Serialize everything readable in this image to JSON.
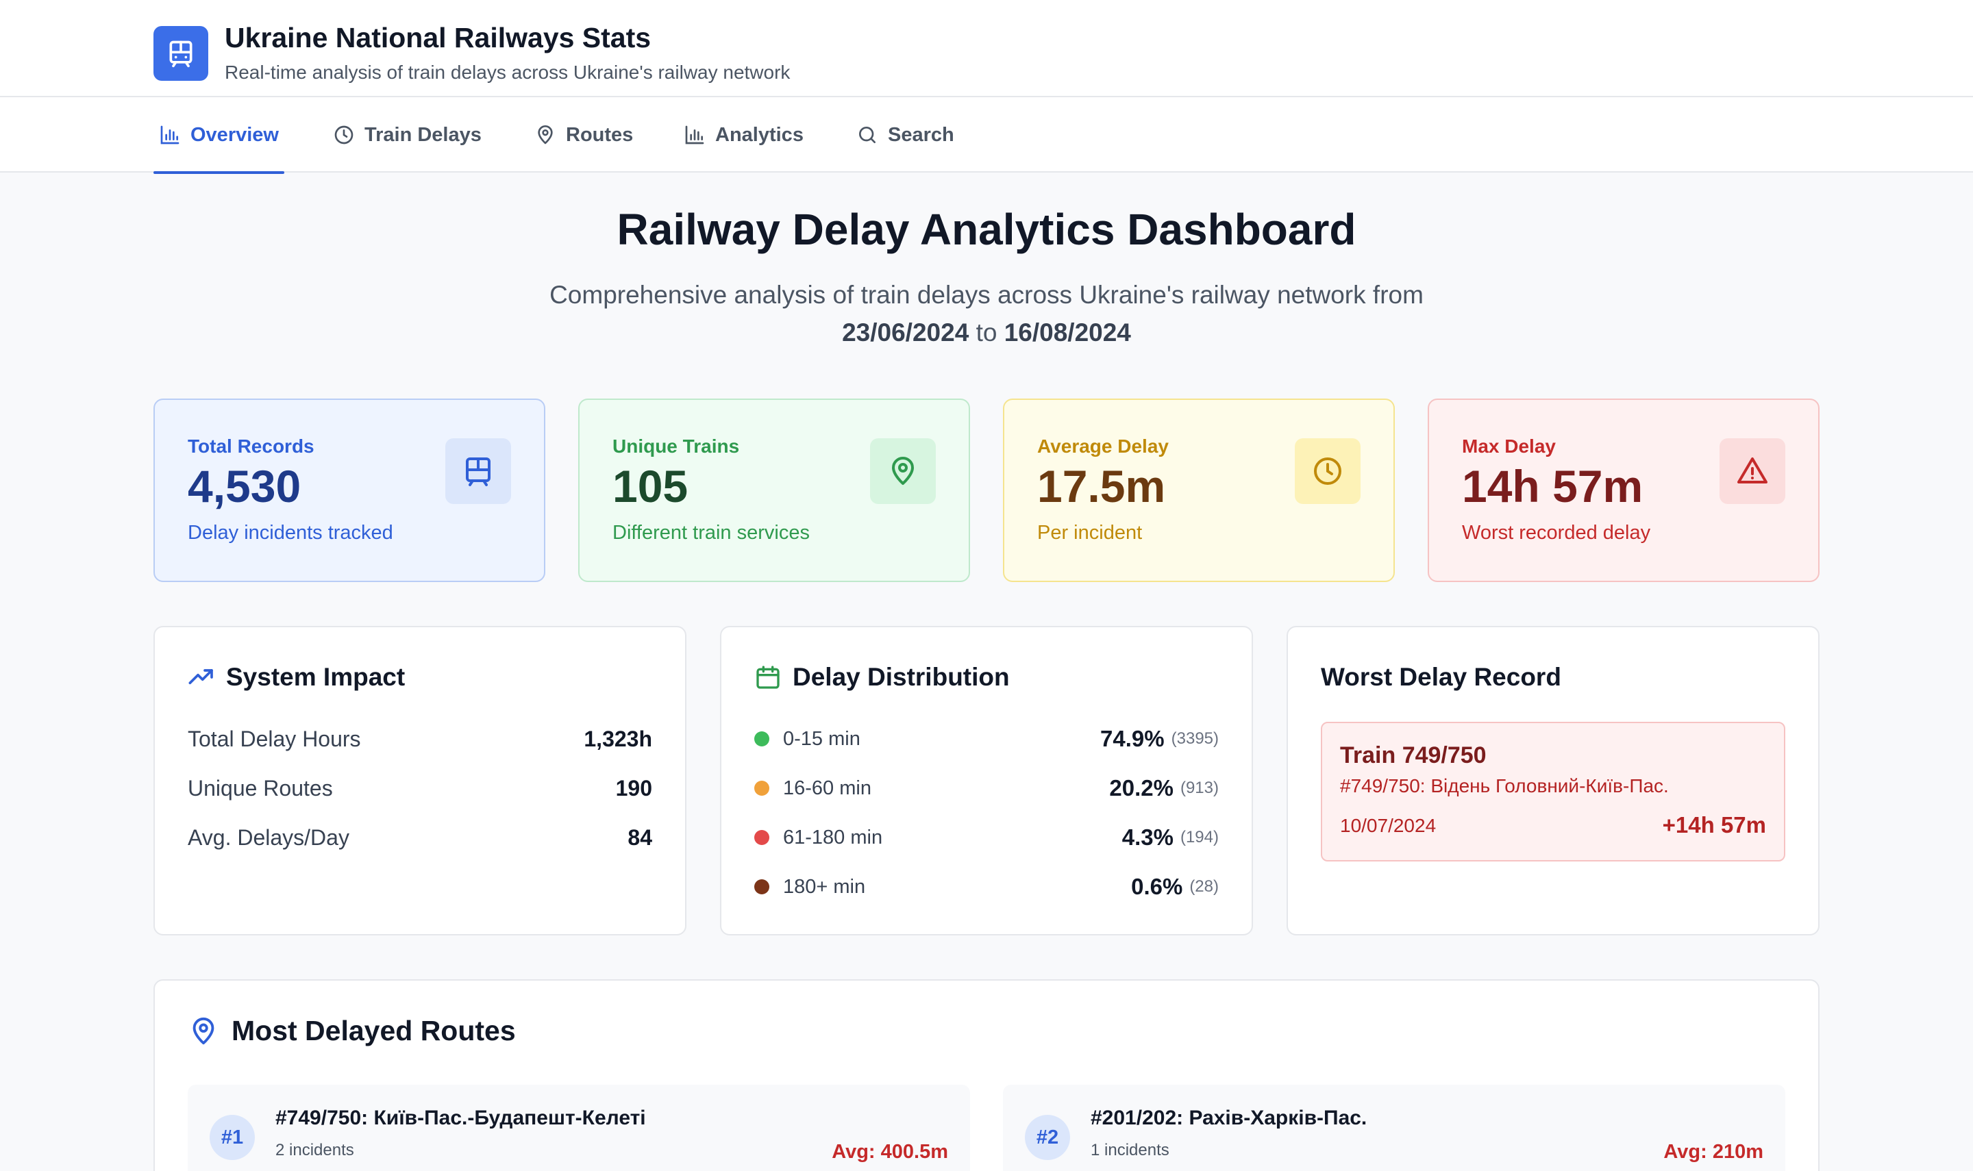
{
  "app": {
    "title": "Ukraine National Railways Stats",
    "subtitle": "Real-time analysis of train delays across Ukraine's railway network",
    "accent": "#2f5fd7"
  },
  "tabs": [
    {
      "label": "Overview",
      "icon": "bar-chart-icon",
      "active": true
    },
    {
      "label": "Train Delays",
      "icon": "clock-icon",
      "active": false
    },
    {
      "label": "Routes",
      "icon": "map-pin-icon",
      "active": false
    },
    {
      "label": "Analytics",
      "icon": "bar-chart-icon",
      "active": false
    },
    {
      "label": "Search",
      "icon": "search-icon",
      "active": false
    }
  ],
  "hero": {
    "title": "Railway Delay Analytics Dashboard",
    "line1": "Comprehensive analysis of train delays across Ukraine's railway network from",
    "start_date": "23/06/2024",
    "connector": "to",
    "end_date": "16/08/2024"
  },
  "stats": [
    {
      "label": "Total Records",
      "value": "4,530",
      "desc": "Delay incidents tracked",
      "icon": "train-icon",
      "color": "#2f5fd7"
    },
    {
      "label": "Unique Trains",
      "value": "105",
      "desc": "Different train services",
      "icon": "map-pin-icon",
      "color": "#2f9a4e"
    },
    {
      "label": "Average Delay",
      "value": "17.5m",
      "desc": "Per incident",
      "icon": "clock-icon",
      "color": "#c08a0a"
    },
    {
      "label": "Max Delay",
      "value": "14h 57m",
      "desc": "Worst recorded delay",
      "icon": "alert-triangle-icon",
      "color": "#c52a2a"
    }
  ],
  "system_impact": {
    "title": "System Impact",
    "rows": [
      {
        "label": "Total Delay Hours",
        "value": "1,323h"
      },
      {
        "label": "Unique Routes",
        "value": "190"
      },
      {
        "label": "Avg. Delays/Day",
        "value": "84"
      }
    ]
  },
  "delay_distribution": {
    "title": "Delay Distribution",
    "rows": [
      {
        "label": "0-15 min",
        "pct": "74.9%",
        "count": "(3395)",
        "color": "#3dbb5b"
      },
      {
        "label": "16-60 min",
        "pct": "20.2%",
        "count": "(913)",
        "color": "#f0a13a"
      },
      {
        "label": "61-180 min",
        "pct": "4.3%",
        "count": "(194)",
        "color": "#e34a4a"
      },
      {
        "label": "180+ min",
        "pct": "0.6%",
        "count": "(28)",
        "color": "#7c3418"
      }
    ]
  },
  "worst_delay": {
    "title": "Worst Delay Record",
    "train": "Train 749/750",
    "route": "#749/750: Відень Головний-Київ-Пас.",
    "date": "10/07/2024",
    "delay": "+14h 57m"
  },
  "most_delayed_routes": {
    "title": "Most Delayed Routes",
    "items": [
      {
        "rank": "#1",
        "name": "#749/750: Київ-Пас.-Будапешт-Келеті",
        "incidents": "2 incidents",
        "avg": "Avg: 400.5m"
      },
      {
        "rank": "#2",
        "name": "#201/202: Рахів-Харків-Пас.",
        "incidents": "1 incidents",
        "avg": "Avg: 210m"
      }
    ]
  }
}
